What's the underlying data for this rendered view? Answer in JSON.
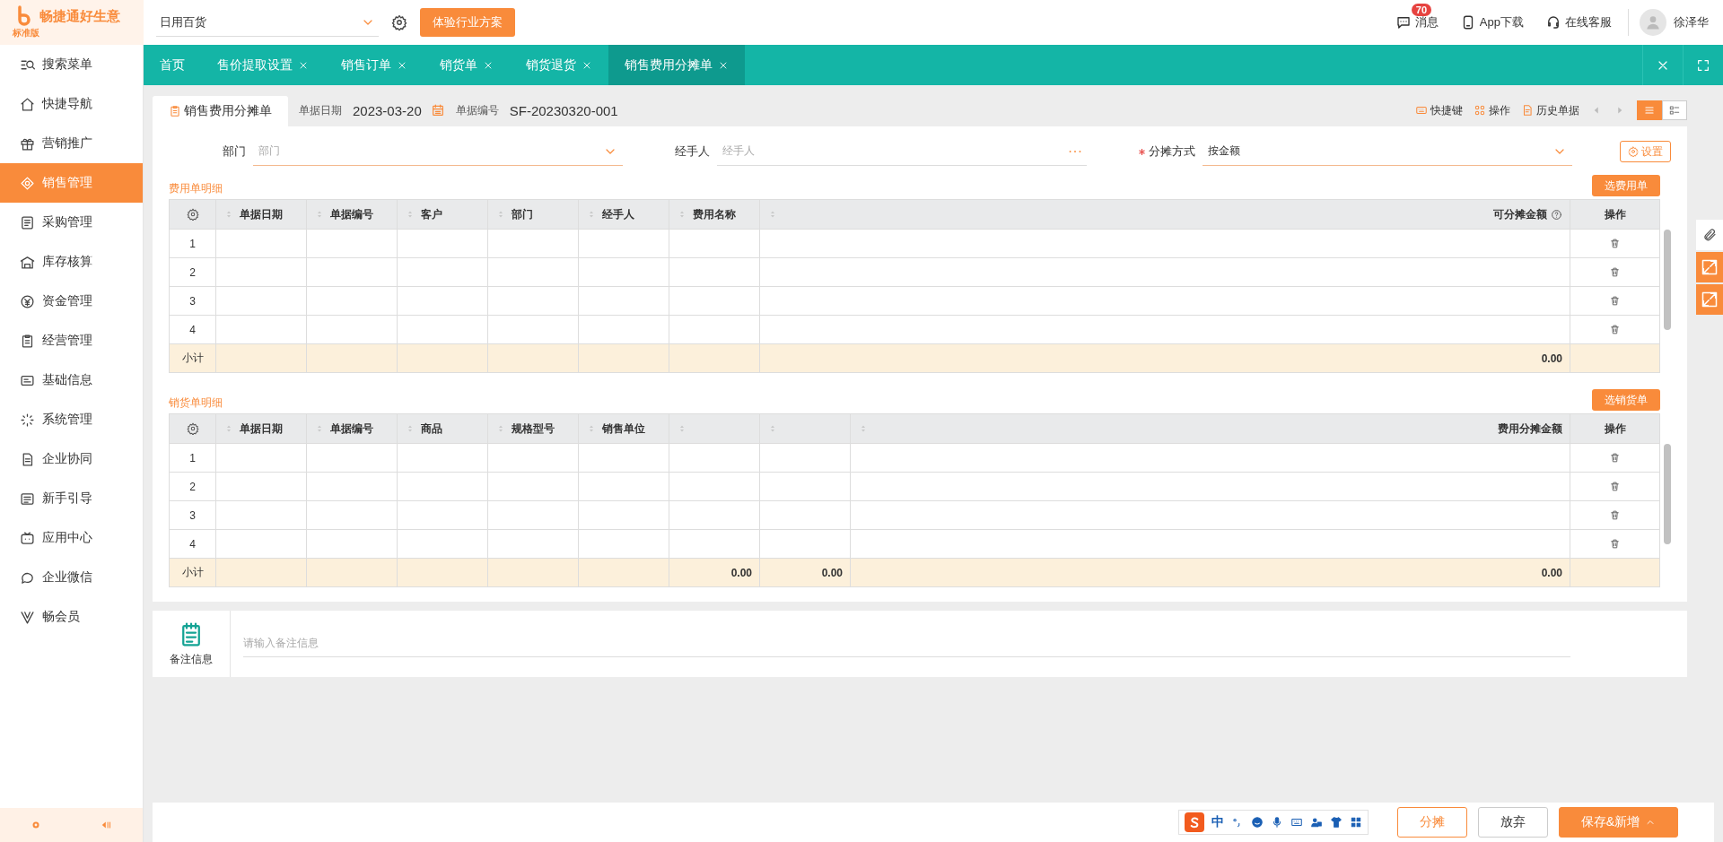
{
  "logo": {
    "name": "畅捷通好生意",
    "edition": "标准版"
  },
  "industry_select": {
    "value": "日用百货"
  },
  "trial_button": "体验行业方案",
  "header_links": [
    {
      "label": "消息",
      "badge": "70",
      "kind": "message"
    },
    {
      "label": "App下载",
      "kind": "phone"
    },
    {
      "label": "在线客服",
      "kind": "headset"
    }
  ],
  "user": {
    "name": "徐泽华"
  },
  "tabs": [
    {
      "label": "首页",
      "closable": false,
      "selected": false
    },
    {
      "label": "售价提取设置",
      "closable": true,
      "selected": false
    },
    {
      "label": "销售订单",
      "closable": true,
      "selected": false
    },
    {
      "label": "销货单",
      "closable": true,
      "selected": false
    },
    {
      "label": "销货退货",
      "closable": true,
      "selected": false
    },
    {
      "label": "销售费用分摊单",
      "closable": true,
      "selected": true
    }
  ],
  "sidebar": {
    "items": [
      {
        "label": "搜索菜单",
        "selected": false
      },
      {
        "label": "快捷导航",
        "selected": false
      },
      {
        "label": "营销推广",
        "selected": false
      },
      {
        "label": "销售管理",
        "selected": true
      },
      {
        "label": "采购管理",
        "selected": false
      },
      {
        "label": "库存核算",
        "selected": false
      },
      {
        "label": "资金管理",
        "selected": false
      },
      {
        "label": "经营管理",
        "selected": false
      },
      {
        "label": "基础信息",
        "selected": false
      },
      {
        "label": "系统管理",
        "selected": false
      },
      {
        "label": "企业协同",
        "selected": false
      },
      {
        "label": "新手引导",
        "selected": false
      },
      {
        "label": "应用中心",
        "selected": false
      },
      {
        "label": "企业微信",
        "selected": false
      },
      {
        "label": "畅会员",
        "selected": false
      }
    ]
  },
  "bill_tab": "销售费用分摊单",
  "bill_date": {
    "label": "单据日期",
    "value": "2023-03-20"
  },
  "bill_number": {
    "label": "单据编号",
    "value": "SF-20230320-001"
  },
  "toolbar": [
    {
      "label": "快捷键",
      "kind": "keyboard"
    },
    {
      "label": "操作",
      "kind": "grid"
    },
    {
      "label": "历史单据",
      "kind": "history"
    }
  ],
  "view_modes": [
    {
      "kind": "list",
      "selected": true
    },
    {
      "kind": "card",
      "selected": false
    }
  ],
  "form": {
    "fields": [
      {
        "label": "部门",
        "placeholder": "部门",
        "kind": "select",
        "required": false
      },
      {
        "label": "经手人",
        "placeholder": "经手人",
        "kind": "lookup",
        "required": false
      },
      {
        "label": "分摊方式",
        "value": "按金额",
        "kind": "select",
        "required": true
      }
    ],
    "settings_button": "设置"
  },
  "sections": [
    {
      "title": "费用单明细",
      "button": "选费用单",
      "action_header": "操作",
      "subtotal_label": "小计",
      "columns": [
        {
          "label": "单据日期",
          "kind": "text"
        },
        {
          "label": "单据编号",
          "kind": "text"
        },
        {
          "label": "客户",
          "kind": "text"
        },
        {
          "label": "部门",
          "kind": "text"
        },
        {
          "label": "经手人",
          "kind": "text"
        },
        {
          "label": "费用名称",
          "kind": "text"
        },
        {
          "label": "可分摊金额",
          "kind": "amount",
          "help": true,
          "subtotal": "0.00"
        }
      ],
      "rows": [
        {
          "index": "1"
        },
        {
          "index": "2"
        },
        {
          "index": "3"
        },
        {
          "index": "4"
        }
      ]
    },
    {
      "title": "销货单明细",
      "button": "选销货单",
      "action_header": "操作",
      "subtotal_label": "小计",
      "columns": [
        {
          "label": "单据日期",
          "kind": "text"
        },
        {
          "label": "单据编号",
          "kind": "text"
        },
        {
          "label": "商品",
          "kind": "text"
        },
        {
          "label": "规格型号",
          "kind": "text"
        },
        {
          "label": "销售单位",
          "kind": "text"
        },
        {
          "kind": "text",
          "subtotal": "0.00"
        },
        {
          "kind": "text",
          "subtotal": "0.00"
        },
        {
          "label": "费用分摊金额",
          "kind": "amount",
          "help": false,
          "subtotal": "0.00"
        }
      ],
      "rows": [
        {
          "index": "1"
        },
        {
          "index": "2"
        },
        {
          "index": "3"
        },
        {
          "index": "4"
        }
      ]
    }
  ],
  "remark": {
    "label": "备注信息",
    "placeholder": "请输入备注信息"
  },
  "ime": {
    "mode": "中"
  },
  "footer_buttons": [
    {
      "label": "分摊",
      "kind": "outline"
    },
    {
      "label": "放弃",
      "kind": "plain"
    },
    {
      "label": "保存&新增",
      "kind": "primary"
    }
  ]
}
